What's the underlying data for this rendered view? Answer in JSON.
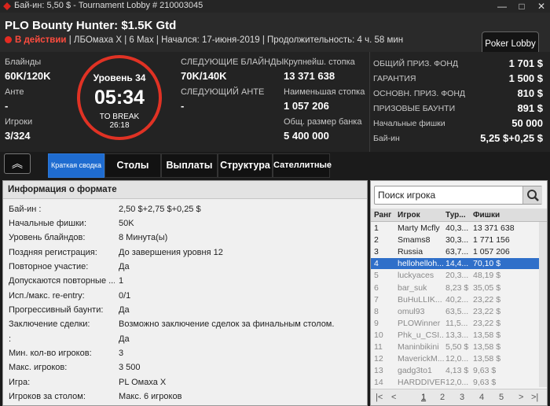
{
  "window": {
    "title": "Бай-ин: 5,50 $ - Tournament Lobby # 210003045",
    "min": "—",
    "max": "□",
    "close": "✕"
  },
  "header": {
    "name": "PLO Bounty Hunter: $1.5K Gtd",
    "status": "В действии",
    "details": "| ЛБОмаха X | 6 Max | Начался: 17-июня-2019 | Продолжительность: 4 ч. 58 мин",
    "lobby_btn": "Poker Lobby"
  },
  "info": {
    "blinds_label": "Блайнды",
    "blinds": "60K/120K",
    "ante_label": "Анте",
    "ante": "-",
    "players_label": "Игроки",
    "players": "3/324",
    "level": "Уровень 34",
    "clock": "05:34",
    "to_break_label": "TO BREAK",
    "to_break": "26:18",
    "next_blinds_label": "СЛЕДУЮЩИЕ БЛАЙНДЫ",
    "next_blinds": "70K/140K",
    "next_ante_label": "СЛЕДУЮЩИЙ АНТЕ",
    "next_ante": "-",
    "largest_label": "Крупнейш. стопка",
    "largest": "13 371 638",
    "smallest_label": "Наименьшая стопка",
    "smallest": "1 057 206",
    "bank_label": "Общ. размер банка",
    "bank": "5 400 000"
  },
  "prize": [
    {
      "label": "ОБЩИЙ ПРИЗ. ФОНД",
      "value": "1 701 $"
    },
    {
      "label": "ГАРАНТИЯ",
      "value": "1 500 $"
    },
    {
      "label": "ОСНОВН. ПРИЗ. ФОНД",
      "value": "810 $"
    },
    {
      "label": "ПРИЗОВЫЕ БАУНТИ",
      "value": "891 $"
    },
    {
      "label": "Начальные фишки",
      "value": "50 000"
    },
    {
      "label": "Бай-ин",
      "value": "5,25 $+0,25 $"
    }
  ],
  "collapse_icon": "︽",
  "tabs": [
    "Краткая сводка",
    "Столы",
    "Выплаты",
    "Структура",
    "Сателлитные"
  ],
  "format": {
    "title": "Информация о формате",
    "rows": [
      {
        "k": "Бай-ин :",
        "v": "2,50 $+2,75 $+0,25 $"
      },
      {
        "k": "Начальные фишки:",
        "v": "50K"
      },
      {
        "k": "Уровень блайндов:",
        "v": "8 Минута(ы)"
      },
      {
        "k": "Поздняя регистрация:",
        "v": "До завершения уровня 12"
      },
      {
        "k": "Повторное участие:",
        "v": "Да"
      },
      {
        "k": "Допускаются повторные ...",
        "v": "1"
      },
      {
        "k": "Исп./макс. re-entry:",
        "v": "0/1"
      },
      {
        "k": "Прогрессивный баунти:",
        "v": "Да"
      },
      {
        "k": "Заключение сделки:",
        "v": "Возможно заключение сделок за финальным столом."
      },
      {
        "k": ":",
        "v": "Да"
      },
      {
        "k": "Мин. кол-во игроков:",
        "v": "3"
      },
      {
        "k": "Макс. игроков:",
        "v": "3 500"
      },
      {
        "k": "Игра:",
        "v": "PL Омаха X"
      },
      {
        "k": "Игроков за столом:",
        "v": "Макс. 6 игроков"
      }
    ]
  },
  "players": {
    "search_placeholder": "Поиск игрока",
    "headers": [
      "Ранг",
      "Игрок",
      "Тур...",
      "Фишки"
    ],
    "rows": [
      {
        "r": "1",
        "n": "Marty Mcfly",
        "t": "40,3...",
        "c": "13 371 638",
        "s": ""
      },
      {
        "r": "2",
        "n": "Smams8",
        "t": "30,3...",
        "c": "1 771 156",
        "s": ""
      },
      {
        "r": "3",
        "n": "Russia",
        "t": "63,7...",
        "c": "1 057 206",
        "s": ""
      },
      {
        "r": "4",
        "n": "hellohelloh...",
        "t": "14,4...",
        "c": "70,10 $",
        "s": "sel"
      },
      {
        "r": "5",
        "n": "luckyaces",
        "t": "20,3...",
        "c": "48,19 $",
        "s": "dim"
      },
      {
        "r": "6",
        "n": "bar_suk",
        "t": "8,23 $",
        "c": "35,05 $",
        "s": "dim"
      },
      {
        "r": "7",
        "n": "BuHuLLIK...",
        "t": "40,2...",
        "c": "23,22 $",
        "s": "dim"
      },
      {
        "r": "8",
        "n": "omul93",
        "t": "63,5...",
        "c": "23,22 $",
        "s": "dim"
      },
      {
        "r": "9",
        "n": "PLOWinner",
        "t": "11,5...",
        "c": "23,22 $",
        "s": "dim"
      },
      {
        "r": "10",
        "n": "Phk_u_CSI...",
        "t": "13,3...",
        "c": "13,58 $",
        "s": "dim"
      },
      {
        "r": "11",
        "n": "Maninbikini",
        "t": "5,50 $",
        "c": "13,58 $",
        "s": "dim"
      },
      {
        "r": "12",
        "n": "MaverickM...",
        "t": "12,0...",
        "c": "13,58 $",
        "s": "dim"
      },
      {
        "r": "13",
        "n": "gadg3to1",
        "t": "4,13 $",
        "c": "9,63 $",
        "s": "dim"
      },
      {
        "r": "14",
        "n": "HARDDIVER",
        "t": "12,0...",
        "c": "9,63 $",
        "s": "dim"
      }
    ],
    "pager": {
      "first": "|<",
      "prev": "<",
      "pages": [
        "1",
        "2",
        "3",
        "4",
        "5"
      ],
      "next": ">",
      "last": ">|"
    }
  }
}
